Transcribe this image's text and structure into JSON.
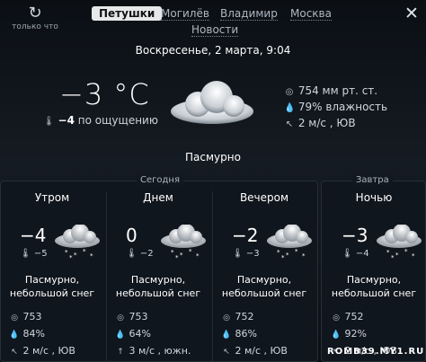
{
  "header": {
    "refresh_label": "только что",
    "tabs": [
      {
        "label": "Петушки"
      },
      {
        "label": "Могилёв"
      },
      {
        "label": "Владимир"
      },
      {
        "label": "Москва"
      },
      {
        "label": "Новости"
      }
    ],
    "active_tab": "Петушки"
  },
  "current": {
    "date": "Воскресенье, 2 марта, 9:04",
    "temp": "−3 °C",
    "feels_value": "−4",
    "feels_label": "по ощущению",
    "pressure": "754 мм рт. ст.",
    "humidity": "79% влажность",
    "wind": "2 м/с , ЮВ",
    "condition": "Пасмурно",
    "icon": "cloud-icon"
  },
  "sections": {
    "today": "Сегодня",
    "tomorrow": "Завтра"
  },
  "forecast": [
    {
      "name": "Утром",
      "temp": "−4",
      "feels": "−5",
      "desc1": "Пасмурно,",
      "desc2": "небольшой снег",
      "pressure": "753",
      "humidity": "84%",
      "wind": "2 м/с , ЮВ"
    },
    {
      "name": "Днем",
      "temp": "0",
      "feels": "−2",
      "desc1": "Пасмурно,",
      "desc2": "небольшой снег",
      "pressure": "753",
      "humidity": "64%",
      "wind": "3 м/с , южн."
    },
    {
      "name": "Вечером",
      "temp": "−2",
      "feels": "−3",
      "desc1": "Пасмурно,",
      "desc2": "небольшой снег",
      "pressure": "752",
      "humidity": "86%",
      "wind": "2 м/с , ЮВ"
    },
    {
      "name": "Ночью",
      "temp": "−3",
      "feels": "−4",
      "desc1": "Пасмурно,",
      "desc2": "небольшой снег",
      "pressure": "752",
      "humidity": "92%",
      "wind": "2 м/с , ЮВ"
    }
  ],
  "watermark": "ROMB39.MY1.RU"
}
